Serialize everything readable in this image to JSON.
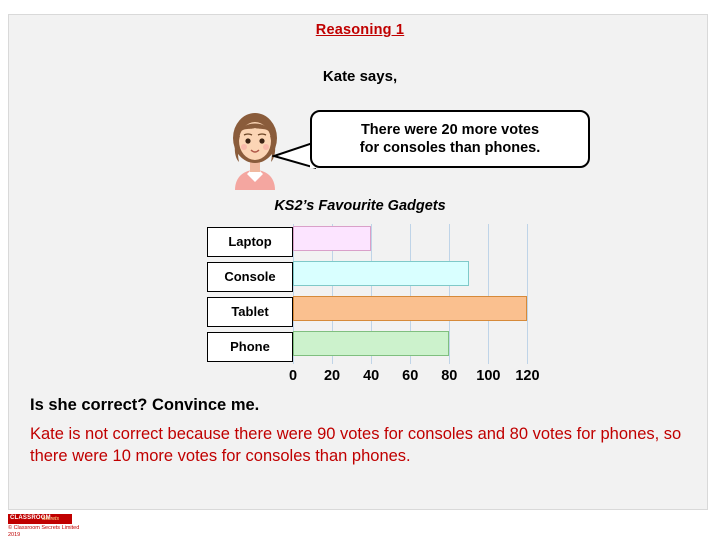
{
  "slide": {
    "title": "Reasoning 1",
    "kate_says": "Kate says,",
    "speech_line1": "There were 20 more votes",
    "speech_line2": "for consoles than phones.",
    "question": "Is she correct? Convince me.",
    "answer": "Kate is not correct because there were 90 votes for consoles and 80 votes for phones, so there were 10 more votes for consoles than phones."
  },
  "footer": {
    "logo": "CLASSROOM",
    "logo_sub": "Secrets",
    "copyright_line1": "© Classroom Secrets Limited",
    "copyright_line2": "2019"
  },
  "chart_data": {
    "type": "bar",
    "orientation": "horizontal",
    "title": "KS2’s Favourite Gadgets",
    "categories": [
      "Laptop",
      "Console",
      "Tablet",
      "Phone"
    ],
    "values": [
      40,
      90,
      120,
      80
    ],
    "colors": [
      "#fce4ff",
      "#d9ffff",
      "#fac08f",
      "#ccf2cc"
    ],
    "border_colors": [
      "#d9a0c9",
      "#7fc9c9",
      "#d68a3a",
      "#7fbf7f"
    ],
    "xlabel": "",
    "ylabel": "",
    "xlim": [
      0,
      130
    ],
    "ticks": [
      0,
      20,
      40,
      60,
      80,
      100,
      120
    ],
    "tick_labels": [
      "0",
      "20",
      "40",
      "60",
      "80",
      "100",
      "120"
    ],
    "grid": true,
    "legend": "none"
  }
}
